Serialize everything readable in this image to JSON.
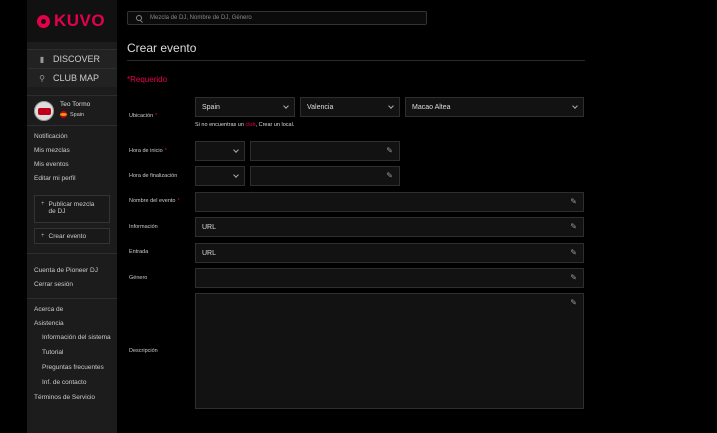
{
  "brand": {
    "name": "KUVO"
  },
  "search": {
    "placeholder": "Mezcla de DJ, Nombre de DJ, Género"
  },
  "nav": [
    {
      "label": "DISCOVER",
      "icon": "building-icon"
    },
    {
      "label": "CLUB MAP",
      "icon": "map-pin-icon"
    }
  ],
  "user": {
    "name": "Teo Tormo",
    "country": "Spain"
  },
  "account_links": [
    "Notificación",
    "Mis mezclas",
    "Mis eventos",
    "Editar mi perfil"
  ],
  "buttons": {
    "publish_mix": "Publicar mezcla de DJ",
    "create_event": "Crear evento"
  },
  "bottom_links": {
    "pioneer_account": "Cuenta de Pioneer DJ",
    "logout": "Cerrar sesión",
    "about": "Acerca de",
    "assistance": "Asistencia"
  },
  "assistance_items": [
    "Información del sistema",
    "Tutorial",
    "Preguntas frecuentes",
    "Inf. de contacto"
  ],
  "terms": "Términos de Servicio",
  "form": {
    "title": "Crear evento",
    "required_label": "Requerido",
    "location_label": "Ubicación",
    "country": "Spain",
    "region": "Valencia",
    "city": "Macao Altea",
    "note_prefix": "Si no encuentras un ",
    "note_link": "club",
    "note_suffix": ", Crear un local.",
    "start_label": "Hora de inicio",
    "end_label": "Hora de finalización",
    "name_label": "Nombre del evento",
    "info_label": "Información",
    "info_value": "URL",
    "entry_label": "Entrada",
    "entry_value": "URL",
    "genre_label": "Género",
    "description_label": "Descripción"
  },
  "colors": {
    "accent": "#e6004c",
    "sidebar": "#1c1c1c",
    "background": "#000000"
  }
}
